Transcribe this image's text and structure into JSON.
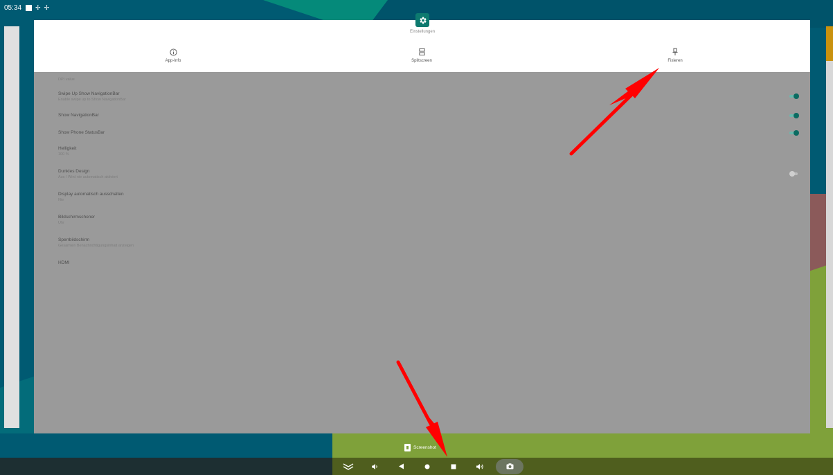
{
  "status_bar": {
    "time": "05:34"
  },
  "card": {
    "app_title": "Einstellungen",
    "menu": [
      {
        "label": "App-Info",
        "icon": "info-icon"
      },
      {
        "label": "Splitscreen",
        "icon": "split-screen-icon"
      },
      {
        "label": "Fixieren",
        "icon": "pin-icon"
      }
    ],
    "settings": [
      {
        "title": "",
        "subtitle": "DPI value"
      },
      {
        "title": "Swipe Up Show NavigationBar",
        "subtitle": "Enable swipe up to Show NavigationBar",
        "toggle": "on"
      },
      {
        "title": "Show NavigationBar",
        "subtitle": "",
        "toggle": "on"
      },
      {
        "title": "Show Phone StatusBar",
        "subtitle": "",
        "toggle": "on"
      },
      {
        "title": "Helligkeit",
        "subtitle": "100 %"
      },
      {
        "title": "Dunkles Design",
        "subtitle": "Aus / Wird nie automatisch aktiviert",
        "toggle": "off"
      },
      {
        "title": "Display automatisch ausschalten",
        "subtitle": "Nie"
      },
      {
        "title": "Bildschirmschoner",
        "subtitle": "Uhr"
      },
      {
        "title": "Sperrbildschirm",
        "subtitle": "Gesamten Benachrichtigungsinhalt anzeigen"
      },
      {
        "title": "HDMI",
        "subtitle": ""
      }
    ]
  },
  "screenshot_label": "Screenshot",
  "nav": {
    "buttons": [
      "collapse-icon",
      "volume-down-icon",
      "back-icon",
      "home-icon",
      "recents-icon",
      "volume-up-icon",
      "camera-icon"
    ]
  },
  "colors": {
    "accent": "#0d7a6f",
    "toggle_on": "#0b6b61",
    "annotation_arrow": "#ff0000"
  }
}
